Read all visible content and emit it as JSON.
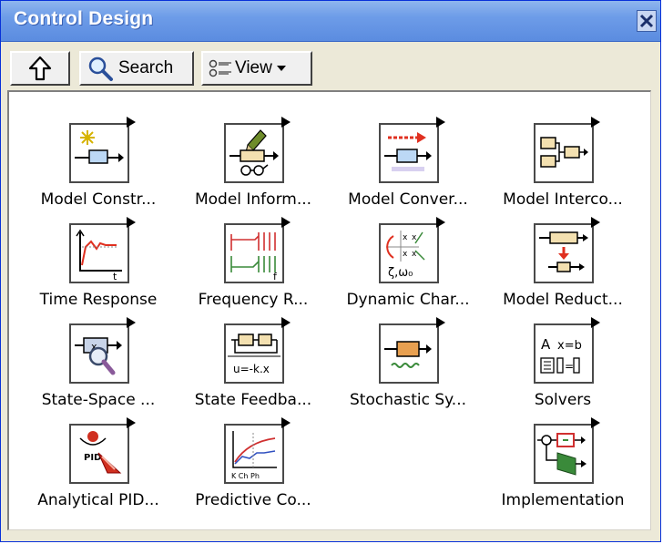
{
  "window": {
    "title": "Control Design"
  },
  "toolbar": {
    "up_icon": "up-arrow-icon",
    "search_label": "Search",
    "view_label": "View"
  },
  "items": [
    {
      "label": "Model Constr...",
      "icon": "model-construction-icon"
    },
    {
      "label": "Model Inform...",
      "icon": "model-information-icon"
    },
    {
      "label": "Model Conver...",
      "icon": "model-conversion-icon"
    },
    {
      "label": "Model Interco...",
      "icon": "model-interconnection-icon"
    },
    {
      "label": "Time Response",
      "icon": "time-response-icon"
    },
    {
      "label": "Frequency R...",
      "icon": "frequency-response-icon"
    },
    {
      "label": "Dynamic Char...",
      "icon": "dynamic-characteristics-icon"
    },
    {
      "label": "Model Reduct...",
      "icon": "model-reduction-icon"
    },
    {
      "label": "State-Space ...",
      "icon": "state-space-icon"
    },
    {
      "label": "State Feedba...",
      "icon": "state-feedback-icon"
    },
    {
      "label": "Stochastic Sy...",
      "icon": "stochastic-systems-icon"
    },
    {
      "label": "Solvers",
      "icon": "solvers-icon"
    },
    {
      "label": "Analytical PID...",
      "icon": "analytical-pid-icon"
    },
    {
      "label": "Predictive Co...",
      "icon": "predictive-control-icon"
    },
    {
      "label": "Implementation",
      "icon": "implementation-icon"
    }
  ]
}
